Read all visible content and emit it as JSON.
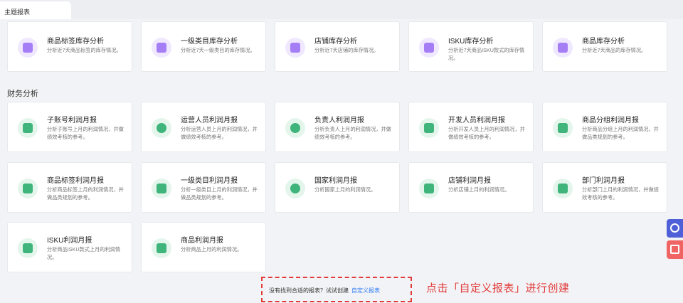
{
  "tab": {
    "label": "主题报表"
  },
  "colors": {
    "accent_purple": "#a57ef5",
    "accent_green": "#3fb47b",
    "link": "#2f7bf5",
    "callout_red": "#e23b3b"
  },
  "inventory_cards": [
    {
      "title": "商品标签库存分析",
      "desc": "分析近7天商品标签的库存情况。",
      "icon": "tag-icon"
    },
    {
      "title": "一级类目库存分析",
      "desc": "分析近7天一级类目的库存情况。",
      "icon": "category-search-icon"
    },
    {
      "title": "店铺库存分析",
      "desc": "分析近7天店铺的库存情况。",
      "icon": "store-icon"
    },
    {
      "title": "ISKU库存分析",
      "desc": "分析近7天商品ISKU款式的库存情况。",
      "icon": "isku-icon"
    },
    {
      "title": "商品库存分析",
      "desc": "分析近7天商品的库存情况。",
      "icon": "box-icon"
    }
  ],
  "section": {
    "finance_title": "财务分析"
  },
  "finance_row1": [
    {
      "title": "子账号利润月报",
      "desc": "分析子账号上月的利润情况，并做绩效考核的参考。",
      "icon": "org-tree-icon"
    },
    {
      "title": "运营人员利润月报",
      "desc": "分析运营人员上月的利润情况，并做绩效考核的参考。",
      "icon": "operator-icon"
    },
    {
      "title": "负责人利润月报",
      "desc": "分析负责人上月的利润情况，并做绩效考核的参考。",
      "icon": "person-icon"
    },
    {
      "title": "开发人员利润月报",
      "desc": "分析开发人员上月的利润情况，并做绩效考核的参考。",
      "icon": "developer-card-icon"
    },
    {
      "title": "商品分组利润月报",
      "desc": "分析商品分组上月的利润情况，并做品类规划的参考。",
      "icon": "layers-icon"
    }
  ],
  "finance_row2": [
    {
      "title": "商品标签利润月报",
      "desc": "分析商品标签上月的利润情况，并做品类规划的参考。",
      "icon": "tag-icon"
    },
    {
      "title": "一级类目利润月报",
      "desc": "分析一级类目上月的利润情况，并做品类规划的参考。",
      "icon": "category-search-icon"
    },
    {
      "title": "国家利润月报",
      "desc": "分析国家上月的利润情况。",
      "icon": "globe-icon"
    },
    {
      "title": "店铺利润月报",
      "desc": "分析店铺上月的利润情况。",
      "icon": "store-icon"
    },
    {
      "title": "部门利润月报",
      "desc": "分析部门上月的利润情况，并做绩效考核的参考。",
      "icon": "team-icon"
    }
  ],
  "finance_row3": [
    {
      "title": "ISKU利润月报",
      "desc": "分析商品ISKU款式上月的利润情况。",
      "icon": "isku-icon"
    },
    {
      "title": "商品利润月报",
      "desc": "分析商品上月的利润情况。",
      "icon": "box-icon"
    }
  ],
  "bottom": {
    "prompt": "没有找到合适的报表？试试创建",
    "link": "自定义报表",
    "callout": "点击「自定义报表」进行创建"
  },
  "side_buttons": {
    "service": "customer-service-icon",
    "gift": "gift-icon"
  }
}
